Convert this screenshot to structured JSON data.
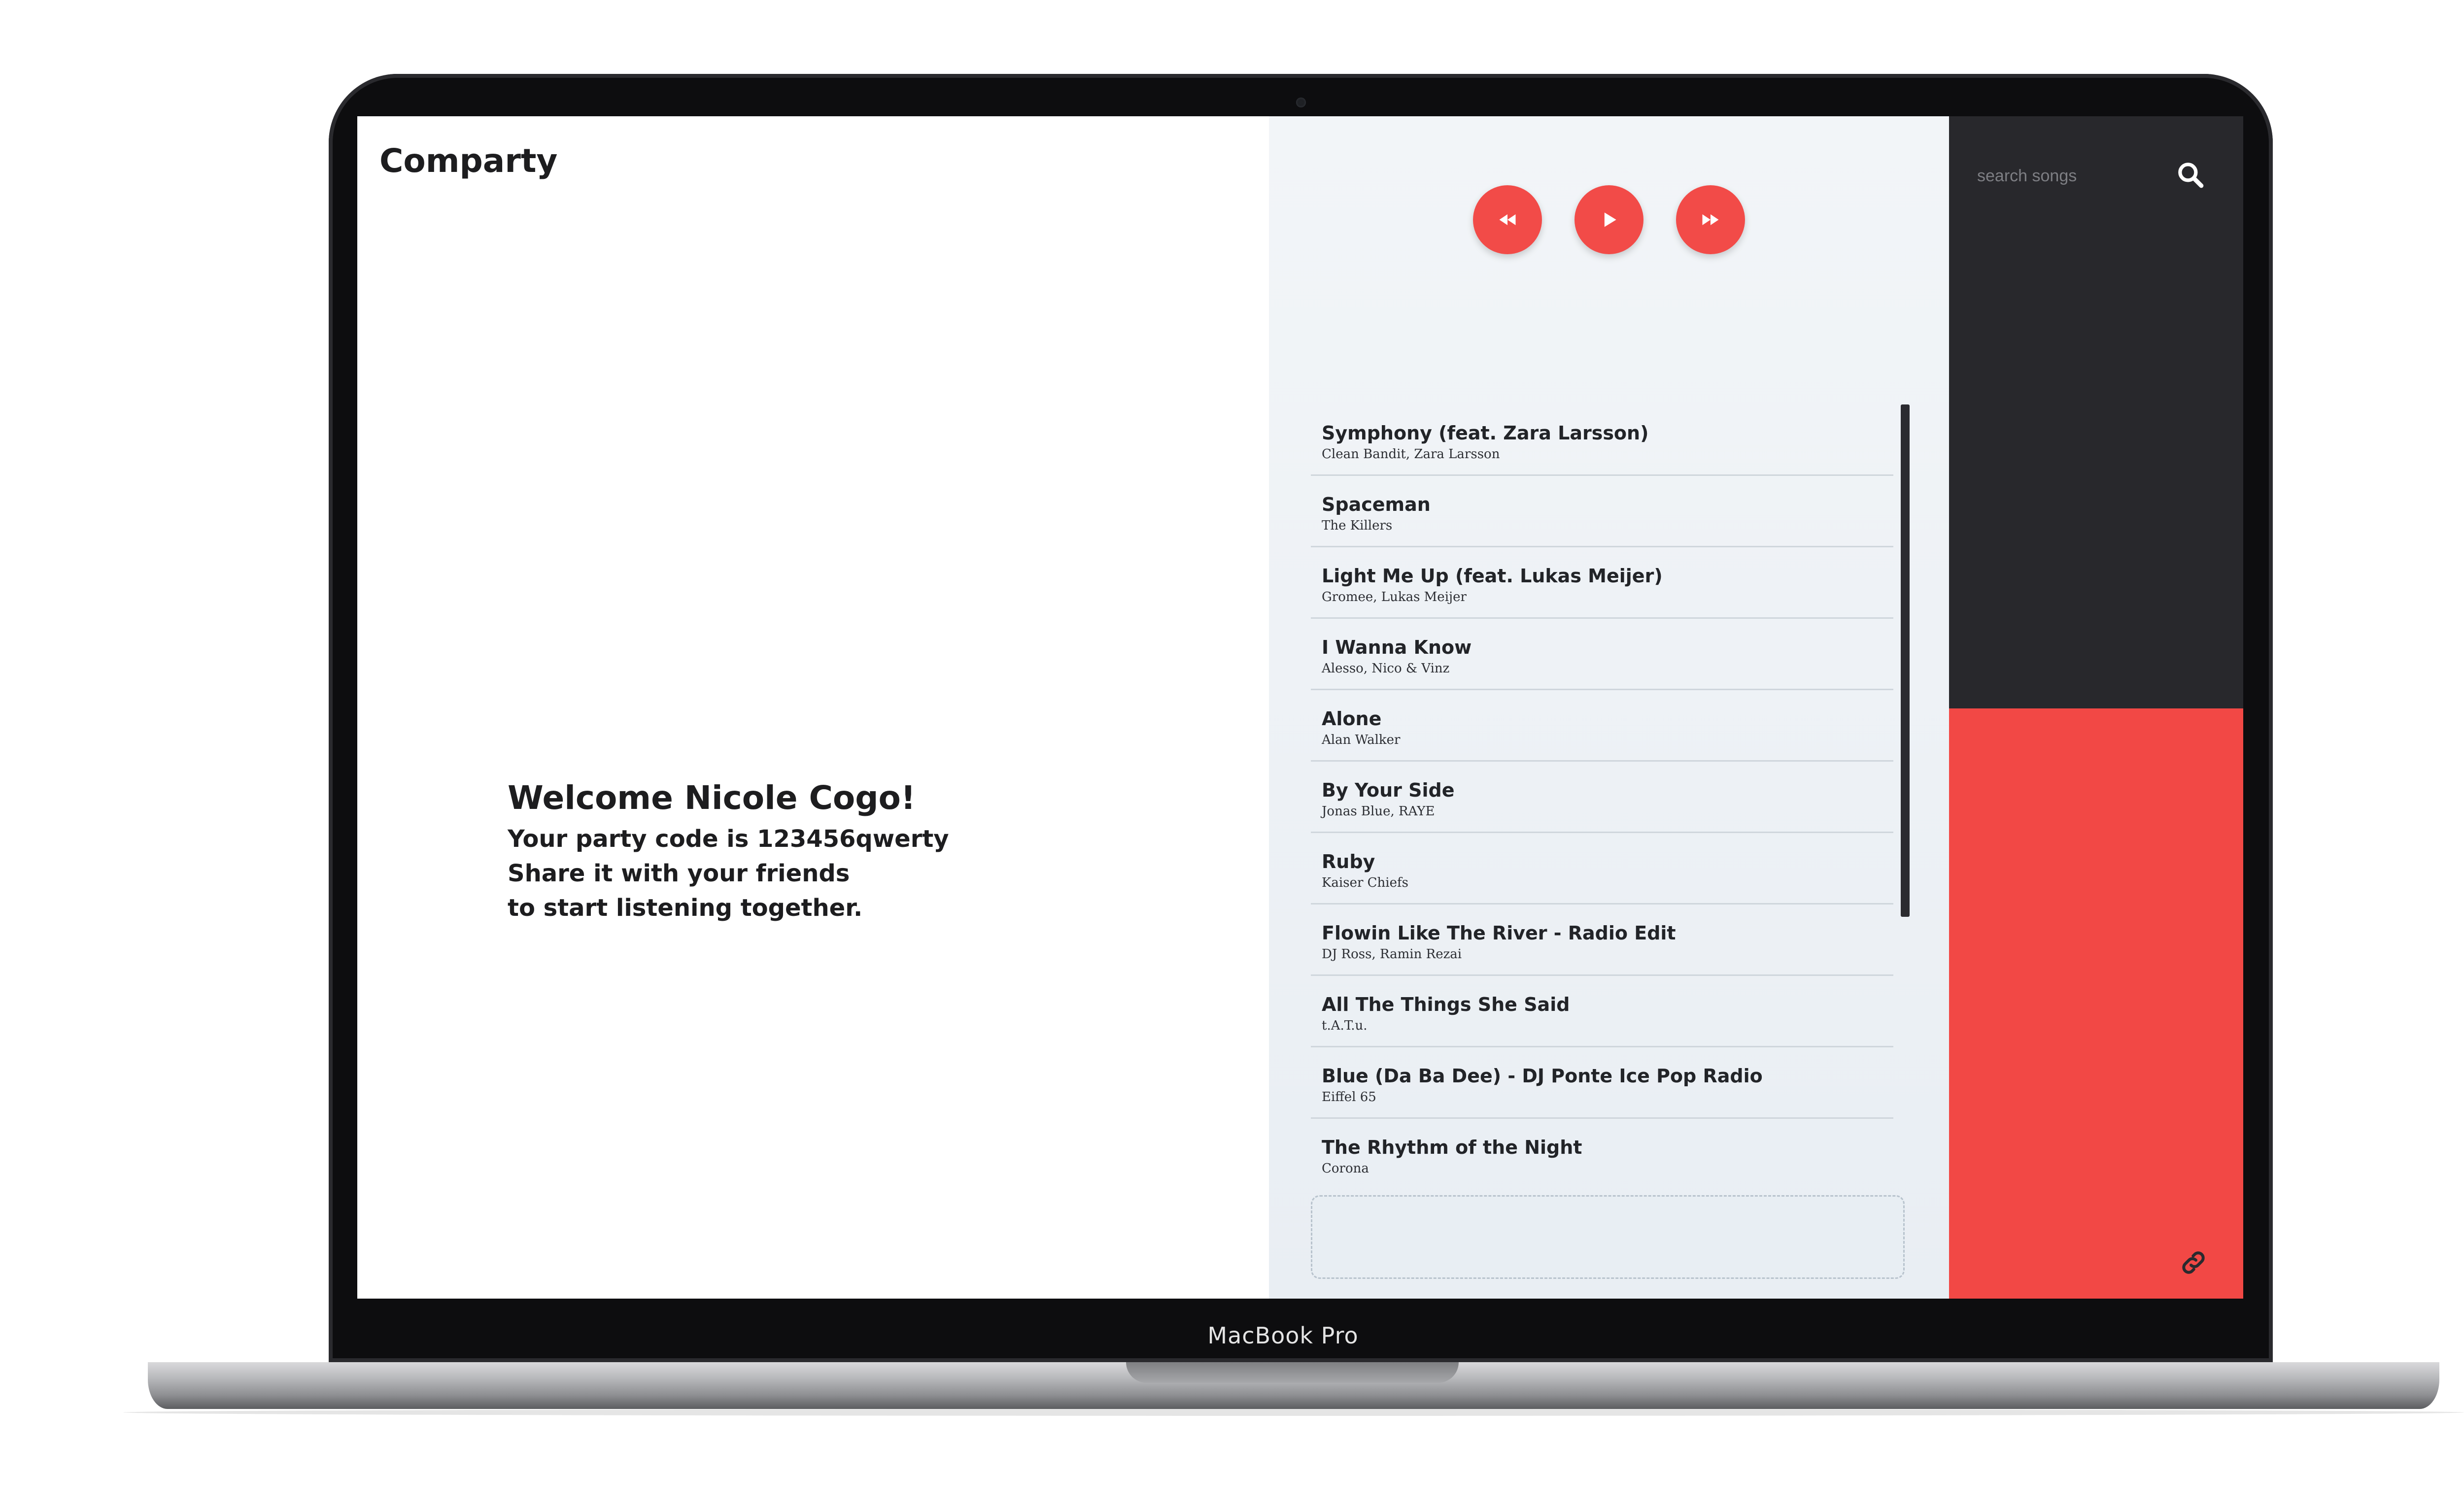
{
  "device": {
    "label": "MacBook Pro"
  },
  "app": {
    "title": "Comparty"
  },
  "welcome": {
    "title": "Welcome Nicole Cogo!",
    "line1": "Your party code is 123456qwerty",
    "line2": "Share it with your friends",
    "line3": "to start listening together."
  },
  "player": {
    "rewind_icon": "rewind-icon",
    "play_icon": "play-icon",
    "forward_icon": "fast-forward-icon",
    "accent_color": "#f24b48"
  },
  "playlist": {
    "songs": [
      {
        "title": "Symphony (feat. Zara Larsson)",
        "artist": "Clean Bandit, Zara Larsson"
      },
      {
        "title": "Spaceman",
        "artist": "The Killers"
      },
      {
        "title": "Light Me Up (feat. Lukas Meijer)",
        "artist": "Gromee, Lukas Meijer"
      },
      {
        "title": "I Wanna Know",
        "artist": "Alesso, Nico & Vinz"
      },
      {
        "title": "Alone",
        "artist": "Alan Walker"
      },
      {
        "title": "By Your Side",
        "artist": "Jonas Blue, RAYE"
      },
      {
        "title": "Ruby",
        "artist": "Kaiser Chiefs"
      },
      {
        "title": "Flowin Like The River - Radio Edit",
        "artist": "DJ Ross, Ramin Rezai"
      },
      {
        "title": "All The Things She Said",
        "artist": "t.A.T.u."
      },
      {
        "title": "Blue (Da Ba Dee) - DJ Ponte Ice Pop Radio",
        "artist": "Eiffel 65"
      },
      {
        "title": "The Rhythm of the Night",
        "artist": "Corona"
      }
    ]
  },
  "search": {
    "placeholder": "search songs",
    "value": "",
    "icon": "search-icon"
  },
  "sidebar": {
    "top_color": "#28282c",
    "bottom_color": "#f24845",
    "link_icon": "link-icon",
    "logout_icon": "sign-out-icon"
  }
}
